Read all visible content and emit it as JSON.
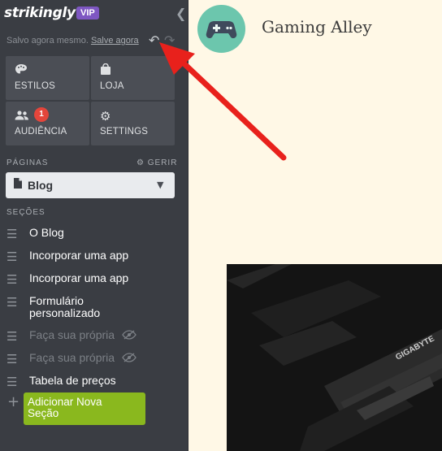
{
  "sidebar": {
    "logo": "strikingly",
    "vip": "VIP",
    "save_status": "Salvo agora mesmo.",
    "save_link": "Salve agora",
    "tiles": [
      {
        "label": "ESTILOS",
        "icon": "palette-icon"
      },
      {
        "label": "LOJA",
        "icon": "shopping-bag-icon"
      },
      {
        "label": "AUDIÊNCIA",
        "icon": "people-icon",
        "badge": "1"
      },
      {
        "label": "SETTINGS",
        "icon": "gear-icon"
      }
    ],
    "pages_title": "PÁGINAS",
    "manage_label": "GERIR",
    "current_page": "Blog",
    "sections_title": "SEÇÕES",
    "sections": [
      {
        "label": "O Blog",
        "hidden": false
      },
      {
        "label": "Incorporar uma app",
        "hidden": false
      },
      {
        "label": "Incorporar uma app",
        "hidden": false
      },
      {
        "label": "Formulário\npersonalizado",
        "hidden": false
      },
      {
        "label": "Faça sua própria",
        "hidden": true
      },
      {
        "label": "Faça sua própria",
        "hidden": true
      },
      {
        "label": "Tabela de preços",
        "hidden": false
      }
    ],
    "add_section": "Adicionar Nova\nSeção"
  },
  "site": {
    "title": "Gaming Alley",
    "image_text": "GIGABYTE"
  },
  "colors": {
    "sidebar_bg": "#3a3d43",
    "accent_green": "#8ab81e",
    "vip_purple": "#7e57c2",
    "badge_red": "#e4453b",
    "arrow_red": "#e8211c",
    "logo_teal": "#6cc6ad",
    "site_bg": "#fff8e6"
  }
}
